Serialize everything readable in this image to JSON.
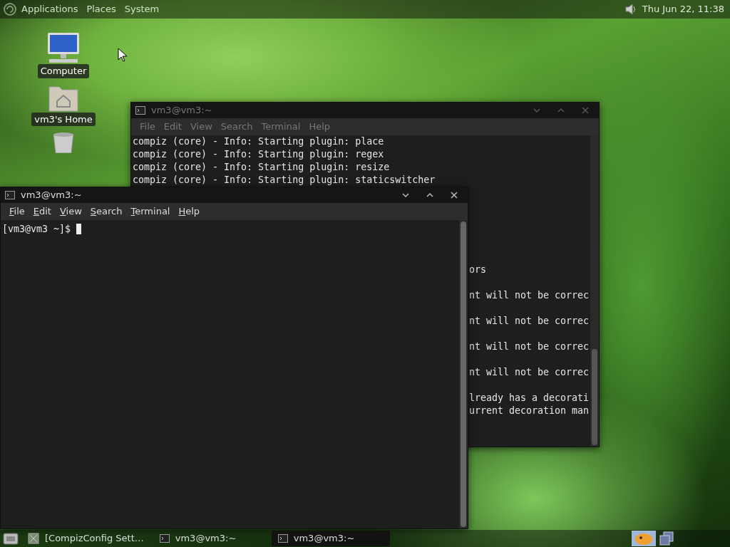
{
  "top_panel": {
    "menus": [
      "Applications",
      "Places",
      "System"
    ],
    "clock": "Thu Jun 22, 11:38"
  },
  "desktop_icons": [
    {
      "kind": "computer",
      "label": "Computer"
    },
    {
      "kind": "home",
      "label": "vm3's Home"
    },
    {
      "kind": "trash"
    }
  ],
  "back_terminal": {
    "title": "vm3@vm3:~",
    "active": false,
    "menu": [
      "File",
      "Edit",
      "View",
      "Search",
      "Terminal",
      "Help"
    ],
    "lines": [
      "compiz (core) - Info: Starting plugin: place",
      "compiz (core) - Info: Starting plugin: regex",
      "compiz (core) - Info: Starting plugin: resize",
      "compiz (core) - Info: Starting plugin: staticswitcher"
    ],
    "fragments": [
      {
        "kind": "after_blank",
        "text": "ors"
      },
      {
        "kind": "after_blank",
        "text": "nt will not be correc"
      },
      {
        "kind": "after_blank",
        "text": "nt will not be correc"
      },
      {
        "kind": "after_blank",
        "text": "nt will not be correc"
      },
      {
        "kind": "after_blank",
        "text": "nt will not be correc"
      },
      {
        "kind": "after_blank",
        "text": "lready has a decorati"
      },
      {
        "kind": "line",
        "text": "urrent decoration man"
      }
    ]
  },
  "front_terminal": {
    "title": "vm3@vm3:~",
    "active": true,
    "menu": [
      "File",
      "Edit",
      "View",
      "Search",
      "Terminal",
      "Help"
    ],
    "prompt": "[vm3@vm3 ~]$"
  },
  "taskbar": {
    "items": [
      {
        "kind": "settings",
        "label": "[CompizConfig Sett…",
        "selected": false
      },
      {
        "kind": "terminal",
        "label": "vm3@vm3:~",
        "selected": false
      },
      {
        "kind": "terminal",
        "label": "vm3@vm3:~",
        "selected": true
      }
    ]
  }
}
